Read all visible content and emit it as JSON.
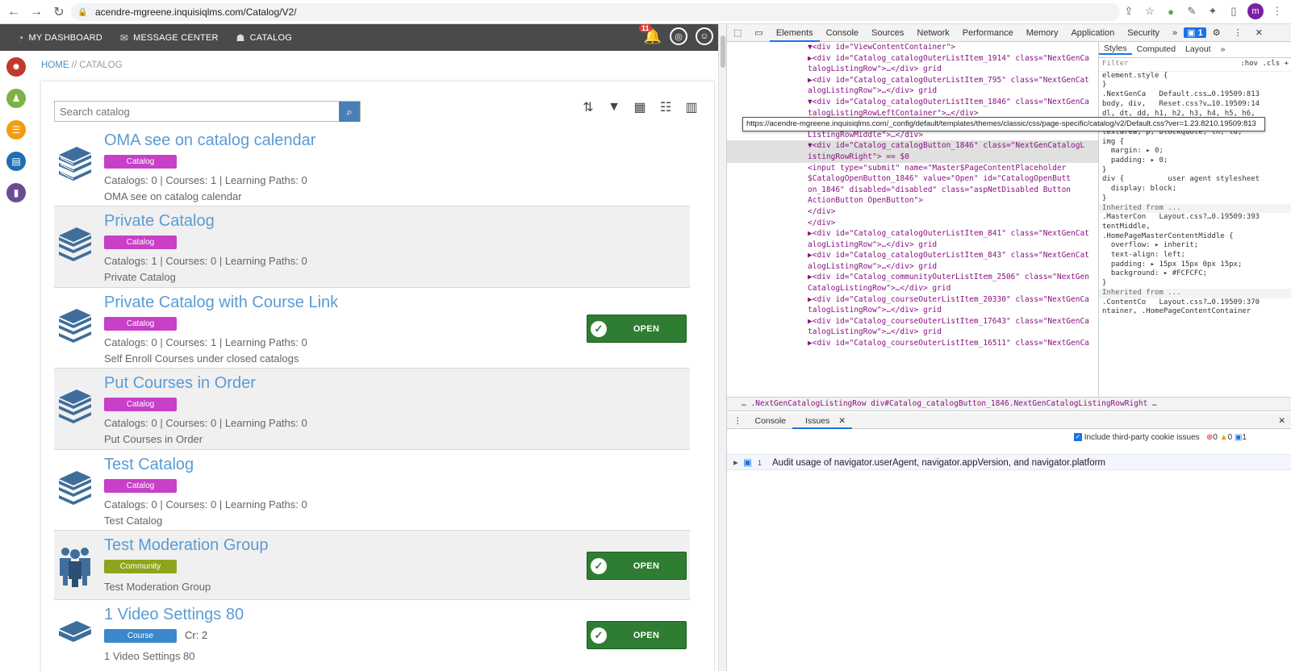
{
  "browser": {
    "url": "acendre-mgreene.inquisiqlms.com/Catalog/V2/",
    "profile_initial": "m"
  },
  "topnav": {
    "dashboard": "MY DASHBOARD",
    "messages": "MESSAGE CENTER",
    "catalog": "CATALOG",
    "notification_count": "11"
  },
  "breadcrumb": {
    "home": "HOME",
    "sep": " // ",
    "current": "CATALOG"
  },
  "search": {
    "placeholder": "Search catalog"
  },
  "colors": {
    "catalog_tag": "#c83fc8",
    "community_tag": "#8ea41b",
    "course_tag": "#3a88cc",
    "open_btn": "#2e7d32",
    "title": "#5a9bd5"
  },
  "rows": [
    {
      "title": "OMA see on catalog calendar",
      "tag": "Catalog",
      "stats": "Catalogs: 0 | Courses: 1 | Learning Paths: 0",
      "desc": "OMA see on catalog calendar",
      "open": ""
    },
    {
      "title": "Private Catalog",
      "tag": "Catalog",
      "stats": "Catalogs: 1 | Courses: 0 | Learning Paths: 0",
      "desc": "Private Catalog",
      "open": ""
    },
    {
      "title": "Private Catalog with Course Link",
      "tag": "Catalog",
      "stats": "Catalogs: 0 | Courses: 1 | Learning Paths: 0",
      "desc": "Self Enroll Courses under closed catalogs",
      "open": "OPEN"
    },
    {
      "title": "Put Courses in Order",
      "tag": "Catalog",
      "stats": "Catalogs: 0 | Courses: 0 | Learning Paths: 0",
      "desc": "Put Courses in Order",
      "open": ""
    },
    {
      "title": "Test Catalog",
      "tag": "Catalog",
      "stats": "Catalogs: 0 | Courses: 0 | Learning Paths: 0",
      "desc": "Test Catalog",
      "open": ""
    },
    {
      "title": "Test Moderation Group",
      "tag": "Community",
      "stats": "",
      "desc": "Test Moderation Group",
      "open": "OPEN"
    },
    {
      "title": "1 Video Settings 80",
      "tag": "Course",
      "cr": "Cr: 2",
      "stats": "",
      "desc": "1 Video Settings 80",
      "open": "OPEN"
    }
  ],
  "devtools": {
    "tabs": [
      "Elements",
      "Console",
      "Sources",
      "Network",
      "Performance",
      "Memory",
      "Application",
      "Security",
      "»"
    ],
    "issues_badge": "1",
    "dom_lines": [
      "▼<div id=\"ViewContentContainer\">",
      "  ▶<div id=\"Catalog_catalogOuterListItem_1914\" class=\"NextGenCa",
      "   talogListingRow\">…</div> grid",
      "  ▶<div id=\"Catalog_catalogOuterListItem_795\" class=\"NextGenCat",
      "   alogListingRow\">…</div> grid",
      "  ▼<div id=\"Catalog_catalogOuterListItem_1846\" class=\"NextGenCa",
      "",
      "     talogListingRowLeftContainer\">…</div>",
      "    ▶<div id=\"Catalog_catalogDetails_1846\" class=\"NextGenCatalog",
      "     ListingRowMiddle\">…</div>",
      "    ▼<div id=\"Catalog_catalogButton_1846\" class=\"NextGenCatalogL",
      "     istingRowRight\"> == $0",
      "       <input type=\"submit\" name=\"Master$PageContentPlaceholder",
      "       $CatalogOpenButton_1846\" value=\"Open\" id=\"CatalogOpenButt",
      "       on_1846\" disabled=\"disabled\" class=\"aspNetDisabled Button",
      "       ActionButton OpenButton\">",
      "     </div>",
      "   </div>",
      "  ▶<div id=\"Catalog_catalogOuterListItem_841\" class=\"NextGenCat",
      "   alogListingRow\">…</div> grid",
      "  ▶<div id=\"Catalog_catalogOuterListItem_843\" class=\"NextGenCat",
      "   alogListingRow\">…</div> grid",
      "  ▶<div id=\"Catalog_communityOuterListItem_2506\" class=\"NextGen",
      "   CatalogListingRow\">…</div> grid",
      "  ▶<div id=\"Catalog_courseOuterListItem_20330\" class=\"NextGenCa",
      "   talogListingRow\">…</div> grid",
      "  ▶<div id=\"Catalog_courseOuterListItem_17643\" class=\"NextGenCa",
      "   talogListingRow\">…</div> grid",
      "  ▶<div id=\"Catalog_courseOuterListItem_16511\" class=\"NextGenCa"
    ],
    "styles_tabs": [
      "Styles",
      "Computed",
      "Layout",
      "»"
    ],
    "styles_filter": "Filter",
    "styles_filter_tools": ":hov .cls +",
    "styles_lines": [
      "element.style {",
      "}",
      ".NextGenCa   Default.css…0.19509:813",
      "",
      "",
      "body, div,   Reset.css?v…10.19509:14",
      "dl, dt, dd, h1, h2, h3, h4, h5, h6,",
      "pre, form, fieldset, input,",
      "textarea, p, blockquote, th, td,",
      "img {",
      "  margin: ▸ 0;",
      "  padding: ▸ 0;",
      "}",
      "div {          user agent stylesheet",
      "  display: block;",
      "}",
      "Inherited from ...",
      ".MasterCon   Layout.css?…0.19509:393",
      "tentMiddle,",
      ".HomePageMasterContentMiddle {",
      "  overflow: ▸ inherit;",
      "  text-align: left;",
      "  padding: ▸ 15px 15px 0px 15px;",
      "  background: ▸ #FCFCFC;",
      "}",
      "Inherited from ...",
      ".ContentCo   Layout.css?…0.19509:370",
      "ntainer, .HomePageContentContainer"
    ],
    "tooltip": "https://acendre-mgreene.inquisiqlms.com/_config/default/templates/themes/classic/css/page-specific/catalog/v2/Default.css?ver=1.23.8210.19509:813",
    "breadcrumb": "… .NextGenCatalogListingRow   div#Catalog_catalogButton_1846.NextGenCatalogListingRowRight   …",
    "drawer_tabs": [
      "Console",
      "Issues"
    ],
    "include_cookies": "Include third-party cookie issues",
    "counts": [
      "0",
      "0",
      "1"
    ],
    "issue_count": "1",
    "issue_text": "Audit usage of navigator.userAgent, navigator.appVersion, and navigator.platform"
  }
}
